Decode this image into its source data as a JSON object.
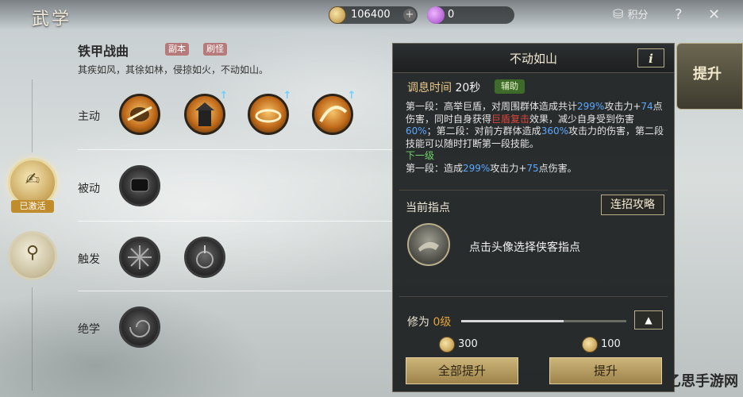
{
  "header": {
    "title": "武学",
    "coins": "106400",
    "gems": "0",
    "points_label": "积分",
    "help_symbol": "?",
    "close_symbol": "✕"
  },
  "categories": [
    {
      "icon": "sword-hand-icon",
      "badge": "已激活"
    },
    {
      "icon": "pouch-icon"
    }
  ],
  "skill_book": {
    "name": "铁甲战曲",
    "tags": [
      "副本",
      "刷怪"
    ],
    "motto": "其疾如风，其徐如林，侵掠如火，不动如山。",
    "rows": [
      {
        "label": "主动",
        "skills": 4
      },
      {
        "label": "被动",
        "skills": 1
      },
      {
        "label": "触发",
        "skills": 2
      },
      {
        "label": "绝学",
        "skills": 1
      }
    ]
  },
  "panel": {
    "skill_title": "不动如山",
    "info_button": "i",
    "cooldown_label": "调息时间",
    "cooldown_value": "20秒",
    "type_tag": "辅助",
    "desc": {
      "p1": "第一段：高举巨盾，对周围群体造成共计",
      "v1": "299%",
      "p2": "攻击力+",
      "v2": "74",
      "p3": "点伤害，同时自身获得",
      "buff": "巨盾复击",
      "p4": "效果，减少自身受到伤害",
      "v3": "60%",
      "p5": "；第二段：对前方群体造成",
      "v4": "360%",
      "p6": "攻击力的伤害，第二段技能可以随时打断第一段技能。",
      "next_label": "下一级",
      "next_p1": "第一段：造成",
      "next_v1": "299%",
      "next_p2": "攻击力+",
      "next_v2": "75",
      "next_p3": "点伤害。"
    },
    "guide_label": "当前指点",
    "combo_button": "连招攻略",
    "portrait_hint": "点击头像选择侠客指点",
    "level_label": "修为",
    "level_value": "0级",
    "level_progress": 0.62,
    "cost_left": "300",
    "cost_right": "100",
    "btn_all": "全部提升",
    "btn_up": "提升"
  },
  "side_tab": "提升",
  "watermark": "乙思手游网"
}
